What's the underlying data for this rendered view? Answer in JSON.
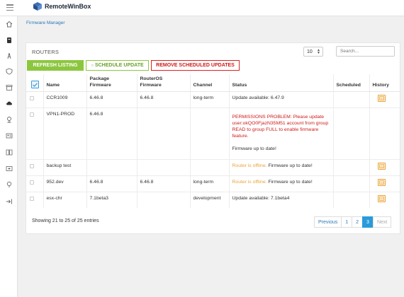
{
  "app": {
    "title": "RemoteWinBox"
  },
  "breadcrumb": "Firmware Manager",
  "panel": {
    "title": "ROUTERS",
    "per_page": "10",
    "search_placeholder": "Search..."
  },
  "actions": {
    "refresh": "REFRESH LISTING",
    "schedule": "SCHEDULE UPDATE",
    "remove": "REMOVE SCHEDULED UPDATES"
  },
  "table": {
    "headers": {
      "name": "Name",
      "package": "Package\nFirmware",
      "routeros": "RouterOS\nFirmware",
      "channel": "Channel",
      "status": "Status",
      "scheduled": "Scheduled",
      "history": "History"
    },
    "rows": [
      {
        "name": "CCR1009",
        "package": "6.46.8",
        "routeros": "6.46.8",
        "channel": "long-term",
        "status": "Update available: 6.47.9",
        "status_prefix": "",
        "scheduled": ""
      },
      {
        "name": "VPN1-PROD",
        "package": "6.46.8",
        "routeros": "",
        "channel": "",
        "status": "Firmware up to date!",
        "status_prefix": "PERMISSIONS PROBLEM: Please update user:okQO0FjazN35M51 account from group READ to group FULL to enable firmware feature.",
        "scheduled": ""
      },
      {
        "name": "backup test",
        "package": "",
        "routeros": "",
        "channel": "",
        "status": " Firmware up to date!",
        "status_prefix": "Router is offline.",
        "scheduled": ""
      },
      {
        "name": "952.dev",
        "package": "6.46.8",
        "routeros": "6.46.8",
        "channel": "long-term",
        "status": " Firmware up to date!",
        "status_prefix": "Router is offline.",
        "scheduled": ""
      },
      {
        "name": "esx-chr",
        "package": "7.1beta3",
        "routeros": "",
        "channel": "development",
        "status": "Update available: 7.1beta4",
        "status_prefix": "",
        "scheduled": ""
      }
    ]
  },
  "footer": {
    "summary": "Showing 21 to 25 of 25 entries"
  },
  "pagination": {
    "previous": "Previous",
    "pages": [
      "1",
      "2",
      "3"
    ],
    "active_page": "3",
    "next": "Next"
  },
  "colors": {
    "accent_green": "#8cc63f",
    "danger_red": "#d01818",
    "warning_orange": "#e8a33a",
    "link_blue": "#2a7ab8",
    "active_blue": "#2a9ad9"
  },
  "icons": {
    "sidebar": [
      "home-icon",
      "router-icon",
      "tower-icon",
      "shield-icon",
      "archive-icon",
      "cloud-upload-icon",
      "map-pin-icon",
      "id-card-icon",
      "book-icon",
      "first-aid-icon",
      "bulb-icon",
      "logout-icon"
    ],
    "history": "history-icon"
  }
}
